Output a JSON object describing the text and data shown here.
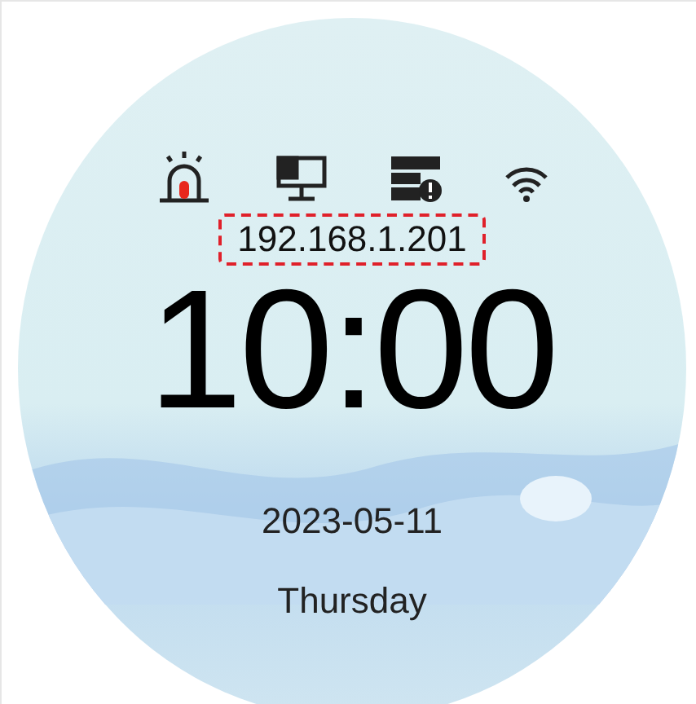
{
  "screen": {
    "ip_address": "192.168.1.201",
    "time": "10:00",
    "date": "2023-05-11",
    "weekday": "Thursday"
  }
}
